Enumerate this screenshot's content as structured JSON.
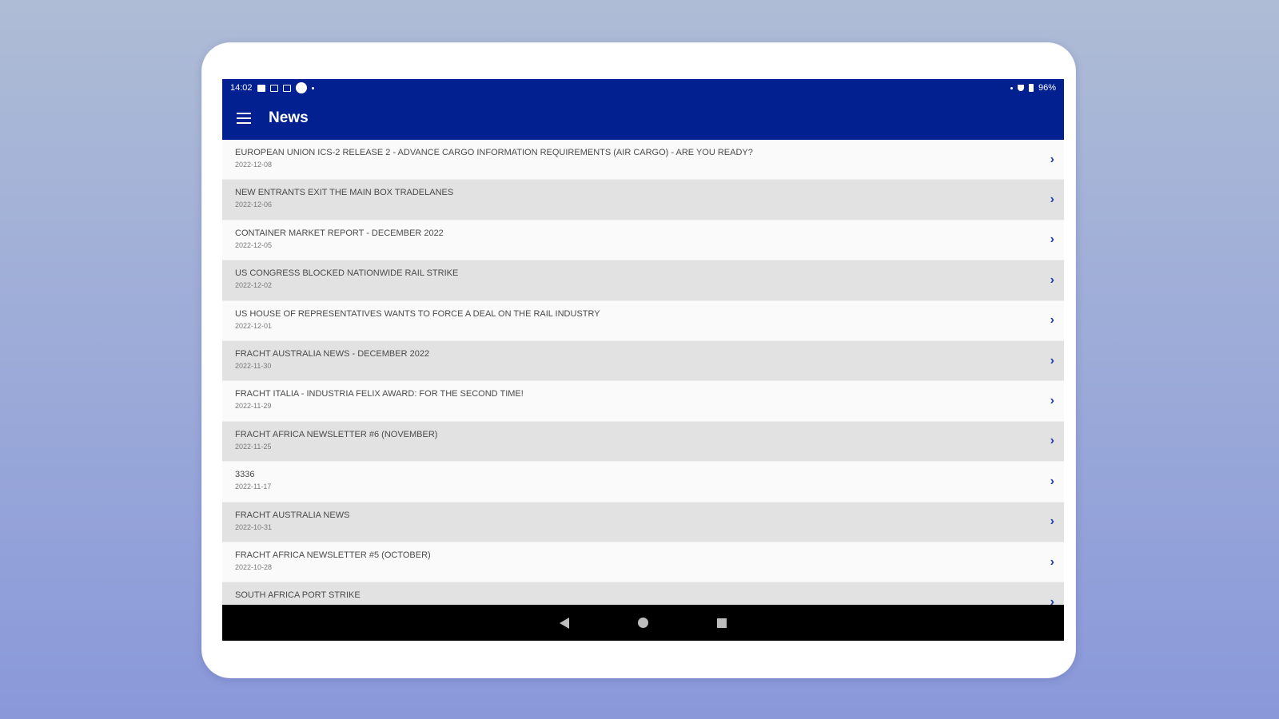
{
  "status_bar": {
    "time": "14:02",
    "battery": "96%"
  },
  "app_bar": {
    "title": "News"
  },
  "news": [
    {
      "title": "EUROPEAN UNION ICS-2 RELEASE 2 - ADVANCE CARGO INFORMATION REQUIREMENTS (AIR CARGO) - ARE YOU READY?",
      "date": "2022-12-08"
    },
    {
      "title": "NEW ENTRANTS EXIT THE MAIN BOX TRADELANES",
      "date": "2022-12-06"
    },
    {
      "title": "CONTAINER MARKET REPORT - DECEMBER 2022",
      "date": "2022-12-05"
    },
    {
      "title": "US CONGRESS BLOCKED NATIONWIDE RAIL STRIKE",
      "date": "2022-12-02"
    },
    {
      "title": "US HOUSE OF REPRESENTATIVES WANTS TO FORCE A DEAL ON THE RAIL INDUSTRY",
      "date": "2022-12-01"
    },
    {
      "title": "FRACHT AUSTRALIA NEWS - DECEMBER 2022",
      "date": "2022-11-30"
    },
    {
      "title": "FRACHT ITALIA - INDUSTRIA FELIX AWARD: FOR THE SECOND TIME!",
      "date": "2022-11-29"
    },
    {
      "title": "FRACHT AFRICA NEWSLETTER #6 (NOVEMBER)",
      "date": "2022-11-25"
    },
    {
      "title": "3336",
      "date": "2022-11-17"
    },
    {
      "title": "FRACHT AUSTRALIA NEWS",
      "date": "2022-10-31"
    },
    {
      "title": " FRACHT AFRICA NEWSLETTER #5 (OCTOBER)",
      "date": "2022-10-28"
    },
    {
      "title": "SOUTH AFRICA PORT STRIKE",
      "date": ""
    }
  ],
  "icons": {
    "menu": "hamburger-icon",
    "chevron": "chevron-right-icon",
    "back": "back-triangle-icon",
    "home": "home-circle-icon",
    "recents": "recents-square-icon"
  }
}
